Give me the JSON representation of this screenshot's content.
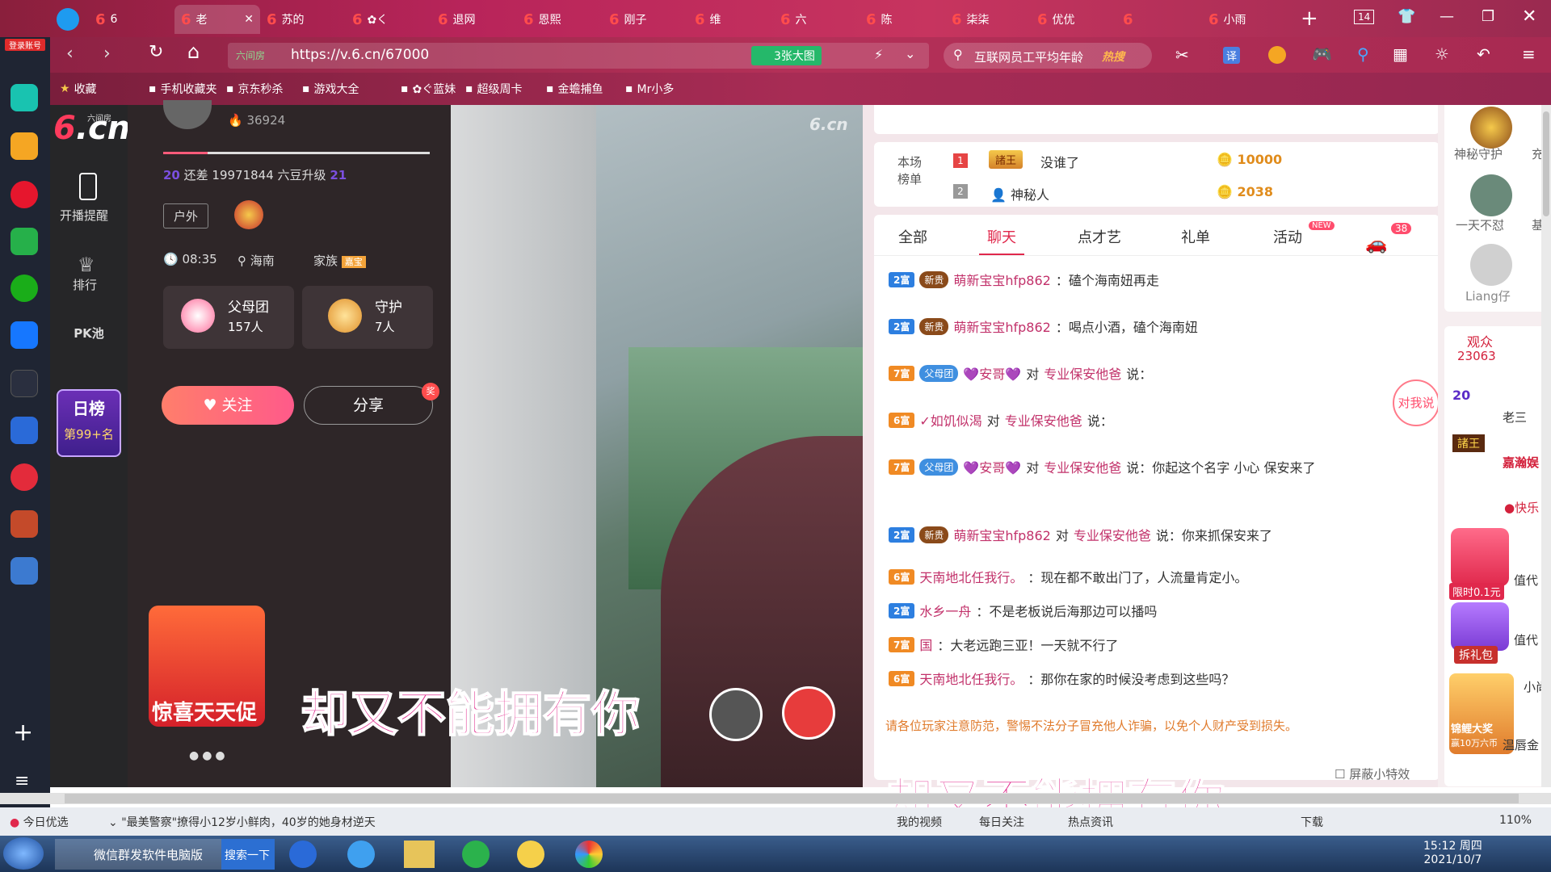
{
  "browser": {
    "tabs": [
      "6",
      "老",
      "苏的",
      "✿く",
      "退网",
      "恩熙",
      "刚子",
      "维",
      "六",
      "陈",
      "柒柒",
      "优优",
      "",
      "小雨"
    ],
    "tab_count": "14",
    "url": "https://v.6.cn/67000",
    "url_prefix": "六间房",
    "image_mode": "3张大图",
    "search_text": "互联网员工平均年龄",
    "search_hot": "热搜",
    "translate": "译",
    "bookmarks": [
      "收藏",
      "手机收藏夹",
      "京东秒杀",
      "游戏大全",
      "✿ぐ蓝妹",
      "超级周卡",
      "金蟾捕鱼",
      "Mr小多"
    ],
    "login": "登录账号"
  },
  "sidenav": {
    "logo": "6.cn",
    "logo_sub": "六间房",
    "items": [
      "开播提醒",
      "排行",
      "PK池"
    ],
    "daily_rank_title": "日榜",
    "daily_rank_value": "第99+名"
  },
  "anchor": {
    "heat": "36924",
    "level_from": "20",
    "level_to": "21",
    "upgrade_text": "还差 19971844 六豆升级",
    "tag": "户外",
    "time": "08:35",
    "location": "海南",
    "family_label": "家族",
    "family_badge": "嘉宝",
    "parents_group": "父母团",
    "parents_count": "157人",
    "guard": "守护",
    "guard_count": "7人",
    "follow": "关注",
    "share": "分享",
    "share_badge": "奖",
    "promo": "惊喜天天促"
  },
  "video": {
    "watermark": "6.cn",
    "caption": "却又不能拥有你"
  },
  "leaderboard": {
    "title": "本场榜单",
    "rows": [
      {
        "rank": "1",
        "name": "没谁了",
        "badge": "諸王",
        "score": "10000"
      },
      {
        "rank": "2",
        "name": "神秘人",
        "score": "2038"
      }
    ]
  },
  "chat": {
    "tabs": [
      "全部",
      "聊天",
      "点才艺",
      "礼单",
      "活动"
    ],
    "new_badge": "NEW",
    "car_count": "38",
    "talk_to_me": "对我说",
    "messages": [
      {
        "lvl": "2富",
        "badge": "新贵",
        "user": "萌新宝宝hfp862",
        "text": "：磕个海南妞再走"
      },
      {
        "lvl": "2富",
        "badge": "新贵",
        "user": "萌新宝宝hfp862",
        "text": "：喝点小酒，磕个海南妞"
      },
      {
        "lvl": "7富",
        "badge": "父母团",
        "user": "💜安哥💜",
        "to": "专业保安他爸",
        "text": "说："
      },
      {
        "lvl": "6富",
        "badge": "",
        "user": "✓如饥似渴",
        "to": "专业保安他爸",
        "text": "说："
      },
      {
        "lvl": "7富",
        "badge": "父母团",
        "user": "💜安哥💜",
        "to": "专业保安他爸",
        "text": "说：你起这个名字 小心 保安来了"
      },
      {
        "lvl": "2富",
        "badge": "新贵",
        "user": "萌新宝宝hfp862",
        "to": "专业保安他爸",
        "text": "说：你来抓保安来了"
      },
      {
        "lvl": "6富",
        "badge": "",
        "user": "天南地北任我行。",
        "text": "：现在都不敢出门了，人流量肯定小。"
      },
      {
        "lvl": "2富",
        "badge": "",
        "user": "水乡一舟",
        "text": "：不是老板说后海那边可以播吗"
      },
      {
        "lvl": "7富",
        "badge": "",
        "user": "国",
        "text": "：大老远跑三亚！一天就不行了"
      },
      {
        "lvl": "6富",
        "badge": "",
        "user": "天南地北任我行。",
        "text": "：那你在家的时候没考虑到这些吗？"
      }
    ],
    "notice": "请各位玩家注意防范，警惕不法分子冒充他人诈骗，以免个人财产受到损失。",
    "effects_toggle": "屏蔽小特效",
    "caption2": "却又不能拥有你"
  },
  "rightcol": {
    "guards": [
      "神秘守护",
      "一天不怼",
      "Liang仔"
    ],
    "guards_side": [
      "充",
      "基"
    ],
    "viewers_label": "观众",
    "viewers_count": "23063",
    "viewers": [
      "老三",
      "嘉瀚娱",
      "●快乐",
      "值代",
      "值代",
      "小尚",
      "温唇金"
    ],
    "promo_red": "限时0.1元",
    "promo_gift": "拆礼包",
    "promo_fish": "锦鲤大奖",
    "promo_fish2": "赢10万六币"
  },
  "statusbar": {
    "today": "今日优选",
    "headline": "\"最美警察\"撩得小12岁小鲜肉，40岁的她身材逆天",
    "items": [
      "我的视频",
      "每日关注",
      "热点资讯",
      "下载"
    ],
    "zoom": "110%"
  },
  "taskbar": {
    "app1": "微信群发软件电脑版",
    "search_btn": "搜索一下",
    "time": "15:12 周四",
    "date": "2021/10/7"
  }
}
